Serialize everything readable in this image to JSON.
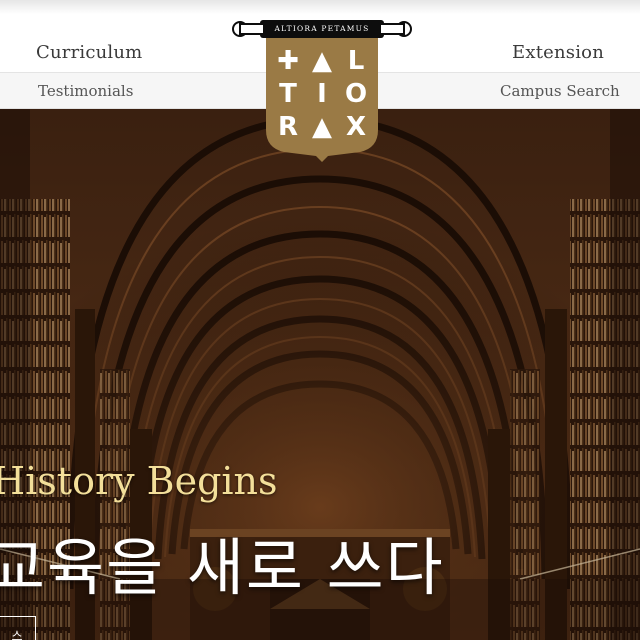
{
  "header": {
    "nav_main": {
      "left": "Curriculum",
      "right": "Extension"
    },
    "nav_sub": {
      "left": "Testimonials",
      "right": "Campus Search"
    }
  },
  "crest": {
    "motto": "ALTIORA PETAMUS",
    "letters": [
      "✚",
      "▲",
      "L",
      "T",
      "I",
      "O",
      "R",
      "▲",
      "X"
    ],
    "colors": {
      "shield": "#9a7a45",
      "scroll": "#0d0d0d"
    }
  },
  "hero": {
    "tagline": "History Begins",
    "title": "교육을 새로 쓰다",
    "button_label": "스"
  },
  "colors": {
    "tagline": "#f3df9a",
    "title": "#ffffff"
  }
}
